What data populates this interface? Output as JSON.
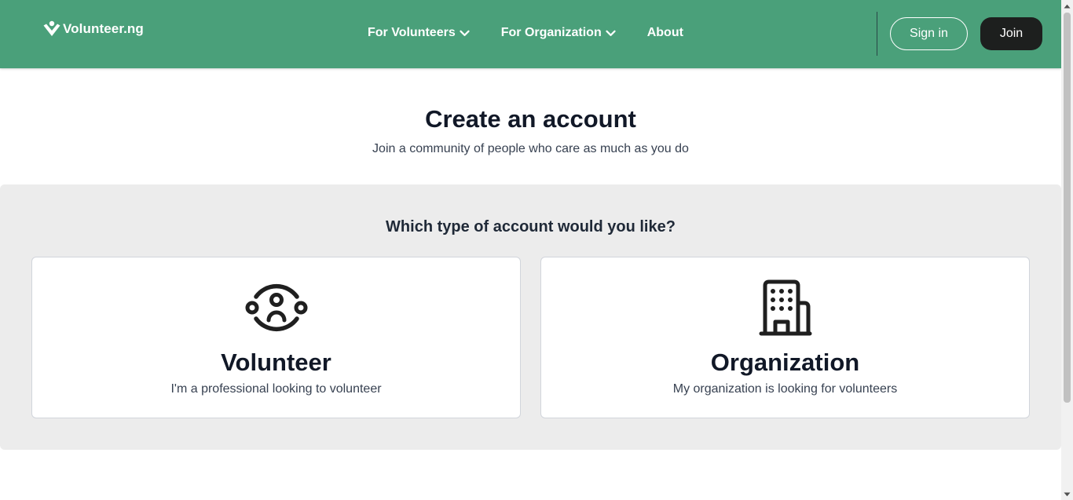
{
  "header": {
    "logo_text": "Volunteer.ng",
    "logo_icon": "heart-person-icon",
    "nav": {
      "for_volunteers": "For Volunteers",
      "for_organization": "For Organization",
      "about": "About"
    },
    "sign_in": "Sign in",
    "join": "Join"
  },
  "hero": {
    "title": "Create an account",
    "subtitle": "Join a community of people who care as much as you do"
  },
  "account_type": {
    "question": "Which type of account would you like?",
    "options": [
      {
        "title": "Volunteer",
        "description": "I'm a professional looking to volunteer",
        "icon": "people-group-icon"
      },
      {
        "title": "Organization",
        "description": "My organization is looking for volunteers",
        "icon": "building-icon"
      }
    ]
  },
  "colors": {
    "header_bg": "#4aa07a",
    "join_bg": "#1d1f1e",
    "panel_bg": "#ececec",
    "text_dark": "#111827"
  }
}
